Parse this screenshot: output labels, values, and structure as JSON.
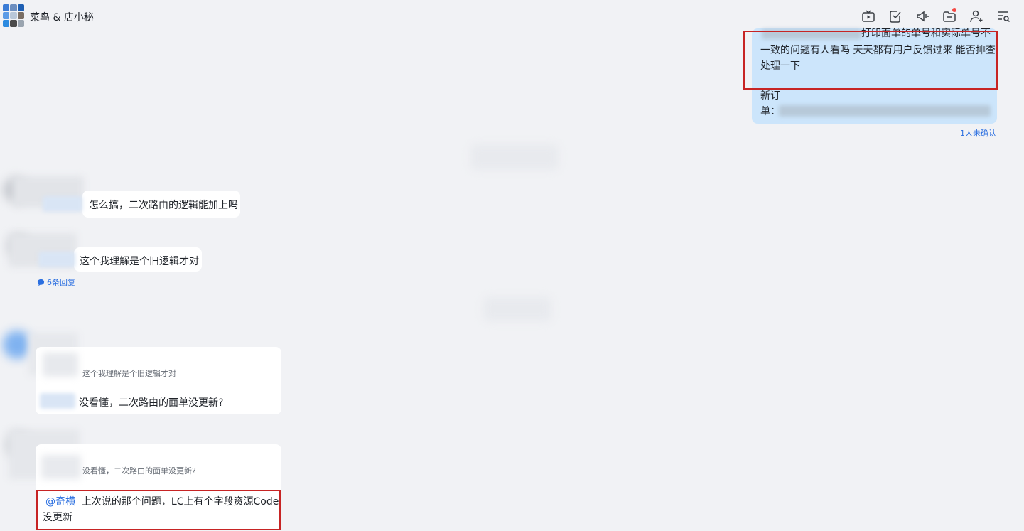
{
  "header": {
    "title": "菜鸟 & 店小秘",
    "icons": [
      "video-icon",
      "task-icon",
      "announcement-icon",
      "docs-icon",
      "add-member-icon",
      "search-history-icon"
    ],
    "notification_color": "#f54a45"
  },
  "messages": {
    "outgoing": {
      "line1": "打印面单的单号和实际单号不",
      "line2": "一致的问题有人看吗 天天都有用户反馈过来 能否排查",
      "line3": "处理一下",
      "order_line1": "新订",
      "order_line2": "单：",
      "read_status": "1人未确认"
    },
    "msg1": {
      "text": "怎么搞，二次路由的逻辑能加上吗"
    },
    "msg2": {
      "text": "这个我理解是个旧逻辑才对",
      "reply_count": "6条回复"
    },
    "msg3": {
      "quote": "这个我理解是个旧逻辑才对",
      "text": "没看懂，二次路由的面单没更新?"
    },
    "msg4": {
      "quote": "没看懂，二次路由的面单没更新?",
      "mention": "@奇横",
      "text": "上次说的那个问题，LC上有个字段资源Code",
      "text2": "没更新"
    }
  },
  "colors": {
    "accent": "#2b6fe0",
    "outgoing_bubble": "#cce5fb",
    "highlight_border": "#c72424"
  }
}
